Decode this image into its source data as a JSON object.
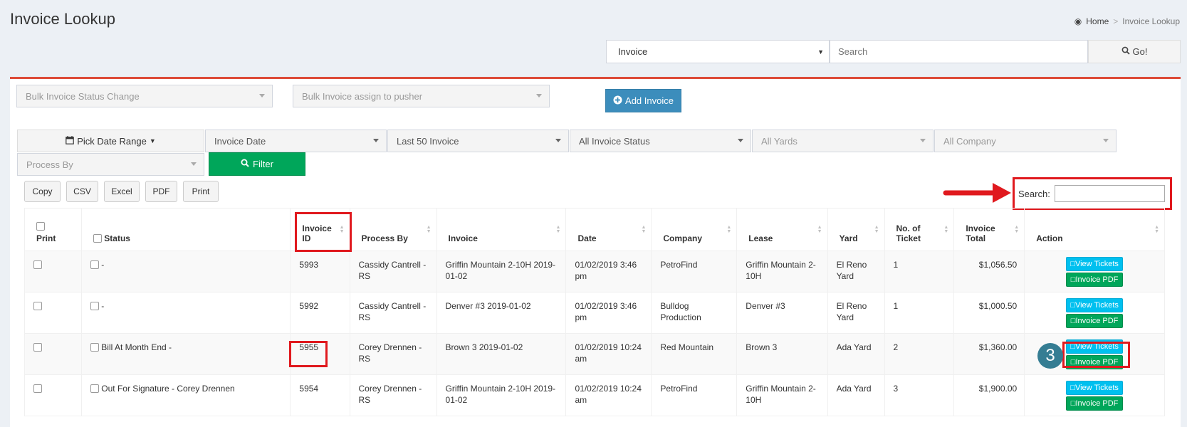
{
  "page": {
    "title": "Invoice Lookup"
  },
  "breadcrumb": {
    "home": "Home",
    "separator": ">",
    "current": "Invoice Lookup"
  },
  "top_search": {
    "type_value": "Invoice",
    "placeholder": "Search",
    "go_label": "Go!"
  },
  "toolbar": {
    "bulk_status": "Bulk Invoice Status Change",
    "bulk_assign": "Bulk Invoice assign to pusher",
    "add_invoice": "Add Invoice"
  },
  "filters": {
    "date_range": "Pick Date Range",
    "date_type": "Invoice Date",
    "limit": "Last 50 Invoice",
    "status": "All Invoice Status",
    "yards": "All Yards",
    "company": "All Company",
    "process_by": "Process By",
    "filter_label": "Filter"
  },
  "export": {
    "buttons": [
      "Copy",
      "CSV",
      "Excel",
      "PDF",
      "Print"
    ]
  },
  "table_search": {
    "label": "Search:"
  },
  "table": {
    "headers": {
      "print": "Print",
      "status": "Status",
      "invoice_id_1": "Invoice",
      "invoice_id_2": "ID",
      "process_by": "Process By",
      "invoice": "Invoice",
      "date": "Date",
      "company": "Company",
      "lease": "Lease",
      "yard": "Yard",
      "tickets_1": "No. of",
      "tickets_2": "Ticket",
      "total_1": "Invoice",
      "total_2": "Total",
      "action": "Action"
    },
    "rows": [
      {
        "status": "-",
        "id": "5993",
        "process_by": "Cassidy Cantrell - RS",
        "invoice": "Griffin Mountain 2-10H 2019-01-02",
        "date": "01/02/2019 3:46 pm",
        "company": "PetroFind",
        "lease": "Griffin Mountain 2-10H",
        "yard": "El Reno Yard",
        "tickets": "1",
        "total": "$1,056.50",
        "view_label": "View Tickets",
        "pdf_label": "Invoice PDF"
      },
      {
        "status": "-",
        "id": "5992",
        "process_by": "Cassidy Cantrell - RS",
        "invoice": "Denver #3 2019-01-02",
        "date": "01/02/2019 3:46 pm",
        "company": "Bulldog Production",
        "lease": "Denver #3",
        "yard": "El Reno Yard",
        "tickets": "1",
        "total": "$1,000.50",
        "view_label": "View Tickets",
        "pdf_label": "Invoice PDF"
      },
      {
        "status": "Bill At Month End -",
        "id": "5955",
        "process_by": "Corey Drennen - RS",
        "invoice": "Brown 3 2019-01-02",
        "date": "01/02/2019 10:24 am",
        "company": "Red Mountain",
        "lease": "Brown 3",
        "yard": "Ada Yard",
        "tickets": "2",
        "total": "$1,360.00",
        "view_label": "View Tickets",
        "pdf_label": "Invoice PDF"
      },
      {
        "status": "Out For Signature - Corey Drennen",
        "id": "5954",
        "process_by": "Corey Drennen - RS",
        "invoice": "Griffin Mountain 2-10H 2019-01-02",
        "date": "01/02/2019 10:24 am",
        "company": "PetroFind",
        "lease": "Griffin Mountain 2-10H",
        "yard": "Ada Yard",
        "tickets": "3",
        "total": "$1,900.00",
        "view_label": "View Tickets",
        "pdf_label": "Invoice PDF"
      }
    ]
  },
  "annotation": {
    "step_number": "3",
    "highlight_color": "#e0191e",
    "badge_color": "#357d93"
  }
}
